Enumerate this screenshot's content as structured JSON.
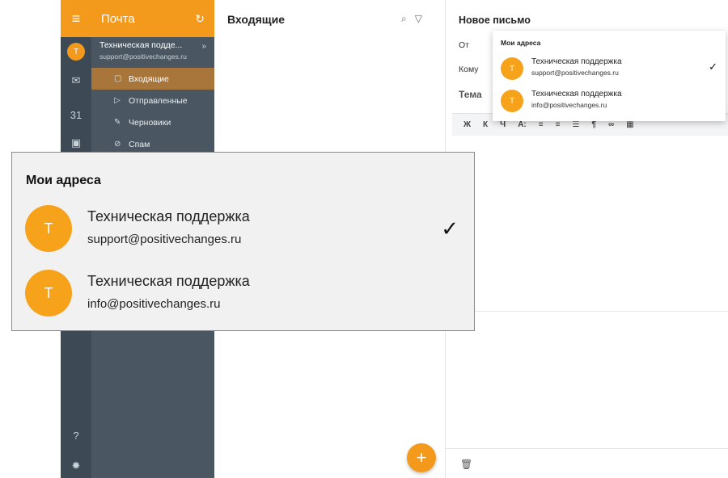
{
  "sidebar": {
    "title": "Почта",
    "account": {
      "initial": "T",
      "name": "Техническая подде...",
      "email": "support@positivechanges.ru"
    },
    "folders": [
      {
        "label": "Входящие",
        "icon": "inbox-icon"
      },
      {
        "label": "Отправленные",
        "icon": "send-icon"
      },
      {
        "label": "Черновики",
        "icon": "draft-icon"
      },
      {
        "label": "Спам",
        "icon": "spam-icon"
      }
    ]
  },
  "rail": {
    "calendar_label": "31"
  },
  "inbox": {
    "title": "Входящие",
    "fab_label": "+"
  },
  "compose": {
    "title": "Новое письмо",
    "from_label": "От",
    "to_label": "Кому",
    "subject_label": "Тема",
    "toolbar": [
      "Ж",
      "К",
      "Ч",
      "A:"
    ]
  },
  "address_menu": {
    "header": "Мои адреса",
    "items": [
      {
        "initial": "T",
        "name": "Техническая поддержка",
        "email": "support@positivechanges.ru",
        "selected": true
      },
      {
        "initial": "T",
        "name": "Техническая поддержка",
        "email": "info@positivechanges.ru",
        "selected": false
      }
    ],
    "check": "✓"
  }
}
